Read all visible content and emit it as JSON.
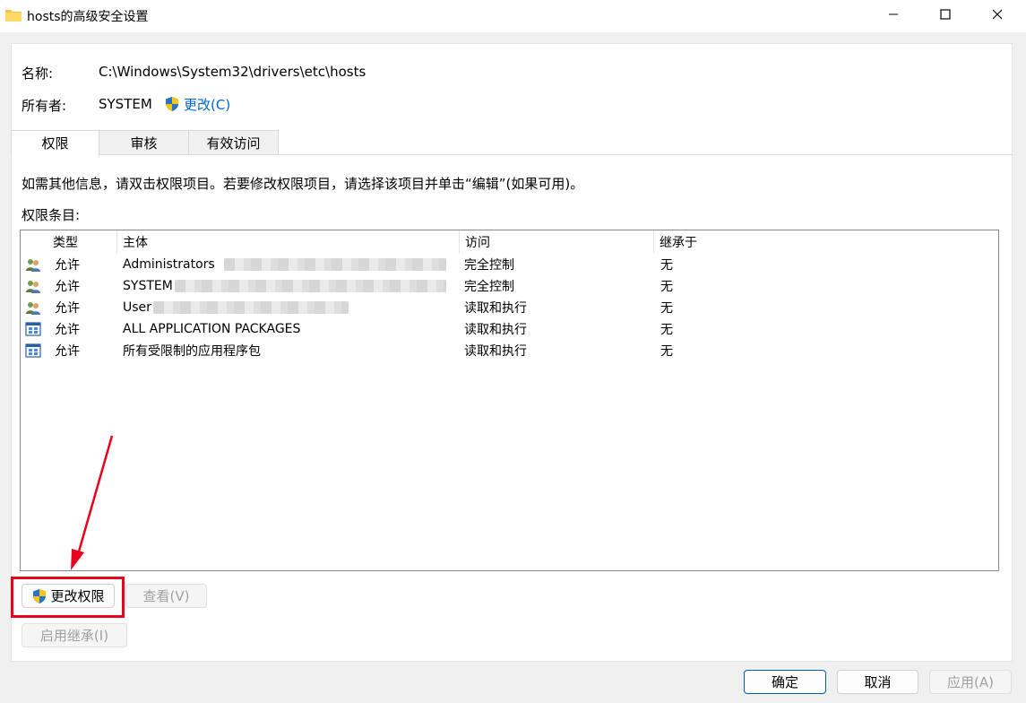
{
  "window": {
    "title": "hosts的高级安全设置",
    "controls": {
      "minimize": "minimize-icon",
      "maximize": "maximize-icon",
      "close": "close-icon"
    }
  },
  "info": {
    "name_label": "名称:",
    "name_value": "C:\\Windows\\System32\\drivers\\etc\\hosts",
    "owner_label": "所有者:",
    "owner_value": "SYSTEM",
    "owner_change": "更改(C)"
  },
  "tabs": [
    {
      "label": "权限",
      "active": true
    },
    {
      "label": "审核",
      "active": false
    },
    {
      "label": "有效访问",
      "active": false
    }
  ],
  "permissions": {
    "hint": "如需其他信息，请双击权限项目。若要修改权限项目，请选择该项目并单击“编辑”(如果可用)。",
    "entries_label": "权限条目:",
    "columns": [
      "类型",
      "主体",
      "访问",
      "继承于"
    ],
    "rows": [
      {
        "icon": "users-icon",
        "type": "允许",
        "principal": "Administrators",
        "access": "完全控制",
        "inherited": "无"
      },
      {
        "icon": "users-icon",
        "type": "允许",
        "principal": "SYSTEM",
        "access": "完全控制",
        "inherited": "无"
      },
      {
        "icon": "users-icon",
        "type": "允许",
        "principal": "User",
        "access": "读取和执行",
        "inherited": "无"
      },
      {
        "icon": "app-package-icon",
        "type": "允许",
        "principal": "ALL APPLICATION PACKAGES",
        "access": "读取和执行",
        "inherited": "无"
      },
      {
        "icon": "app-package-icon",
        "type": "允许",
        "principal": "所有受限制的应用程序包",
        "access": "读取和执行",
        "inherited": "无"
      }
    ]
  },
  "buttons": {
    "change_permissions": "更改权限",
    "view": "查看(V)",
    "enable_inheritance": "启用继承(I)",
    "ok": "确定",
    "cancel": "取消",
    "apply": "应用(A)"
  },
  "colors": {
    "link": "#0066cc",
    "highlight": "#e8001c",
    "primary_border": "#005fb8"
  }
}
